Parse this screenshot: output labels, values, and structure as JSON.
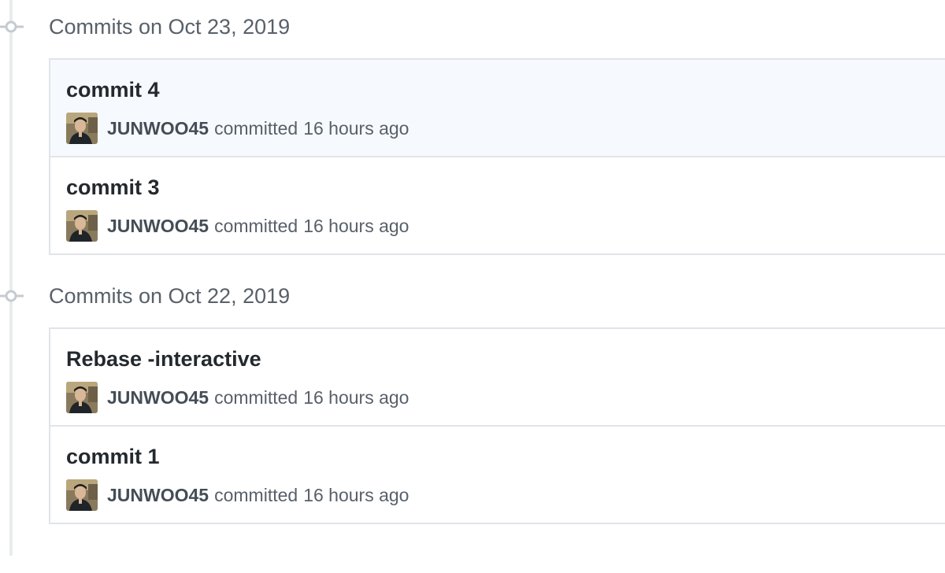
{
  "groups": [
    {
      "date_label": "Commits on Oct 23, 2019",
      "commits": [
        {
          "title": "commit 4",
          "author": "JUNWOO45",
          "action": "committed",
          "time": "16 hours ago",
          "highlighted": true
        },
        {
          "title": "commit 3",
          "author": "JUNWOO45",
          "action": "committed",
          "time": "16 hours ago",
          "highlighted": false
        }
      ]
    },
    {
      "date_label": "Commits on Oct 22, 2019",
      "commits": [
        {
          "title": "Rebase -interactive",
          "author": "JUNWOO45",
          "action": "committed",
          "time": "16 hours ago",
          "highlighted": false
        },
        {
          "title": "commit 1",
          "author": "JUNWOO45",
          "action": "committed",
          "time": "16 hours ago",
          "highlighted": false
        }
      ]
    }
  ],
  "colors": {
    "timeline": "#e9ecef",
    "highlight_bg": "#f6fafe",
    "border": "#e1e4e8",
    "muted_text": "#586069"
  },
  "icons": {
    "timeline_node": "git-commit-icon",
    "avatar": "user-avatar"
  }
}
